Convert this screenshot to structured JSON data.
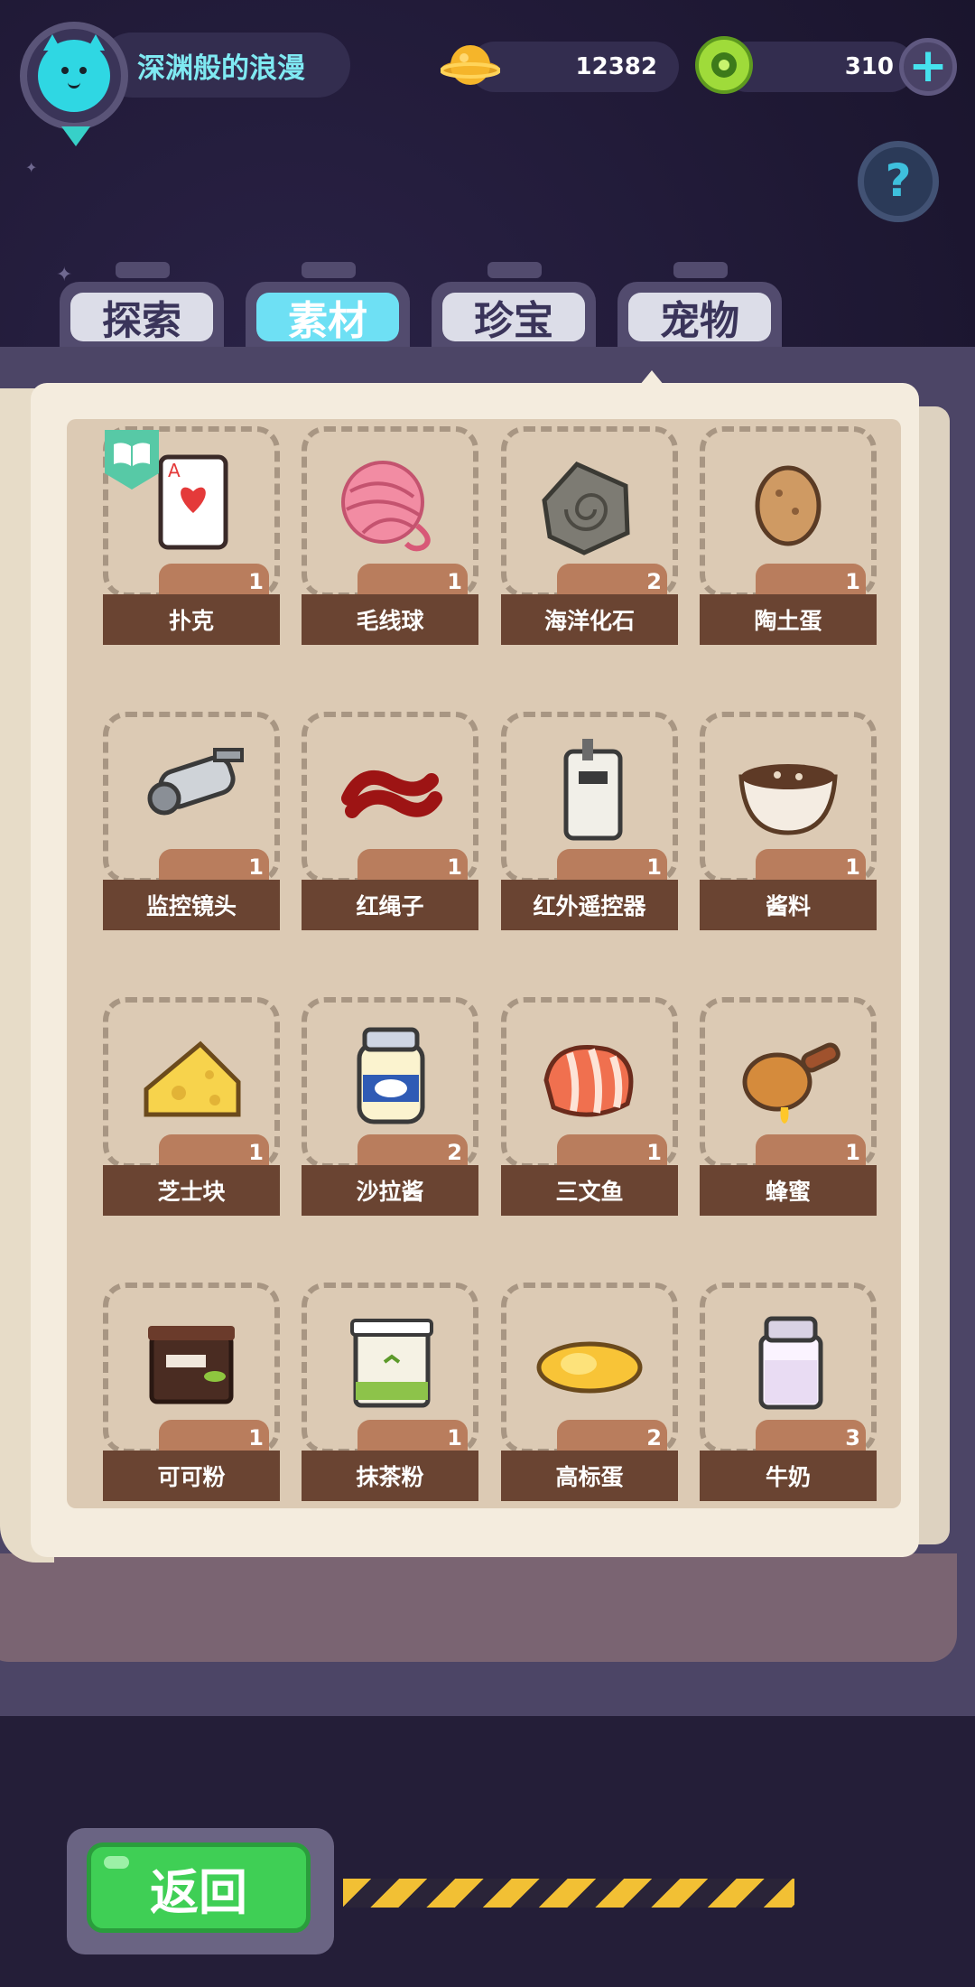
{
  "user": {
    "name": "深渊般的浪漫"
  },
  "currency": {
    "coins": "12382",
    "gems": "310"
  },
  "tabs": [
    {
      "label": "探索",
      "active": false
    },
    {
      "label": "素材",
      "active": true
    },
    {
      "label": "珍宝",
      "active": false
    },
    {
      "label": "宠物",
      "active": false
    }
  ],
  "items": [
    {
      "name": "扑克",
      "count": "1",
      "icon": "poker-card-icon"
    },
    {
      "name": "毛线球",
      "count": "1",
      "icon": "yarn-ball-icon"
    },
    {
      "name": "海洋化石",
      "count": "2",
      "icon": "ocean-fossil-icon"
    },
    {
      "name": "陶土蛋",
      "count": "1",
      "icon": "clay-egg-icon"
    },
    {
      "name": "监控镜头",
      "count": "1",
      "icon": "security-camera-icon"
    },
    {
      "name": "红绳子",
      "count": "1",
      "icon": "red-rope-icon"
    },
    {
      "name": "红外遥控器",
      "count": "1",
      "icon": "remote-control-icon"
    },
    {
      "name": "酱料",
      "count": "1",
      "icon": "sauce-bowl-icon"
    },
    {
      "name": "芝士块",
      "count": "1",
      "icon": "cheese-icon"
    },
    {
      "name": "沙拉酱",
      "count": "2",
      "icon": "mayonnaise-jar-icon"
    },
    {
      "name": "三文鱼",
      "count": "1",
      "icon": "salmon-icon"
    },
    {
      "name": "蜂蜜",
      "count": "1",
      "icon": "honey-dipper-icon"
    },
    {
      "name": "可可粉",
      "count": "1",
      "icon": "cocoa-box-icon"
    },
    {
      "name": "抹茶粉",
      "count": "1",
      "icon": "matcha-jar-icon"
    },
    {
      "name": "高标蛋",
      "count": "2",
      "icon": "fried-egg-icon"
    },
    {
      "name": "牛奶",
      "count": "3",
      "icon": "milk-bottle-icon"
    }
  ],
  "buttons": {
    "back": "返回"
  },
  "icons": {
    "help": "?",
    "plus": "+"
  }
}
